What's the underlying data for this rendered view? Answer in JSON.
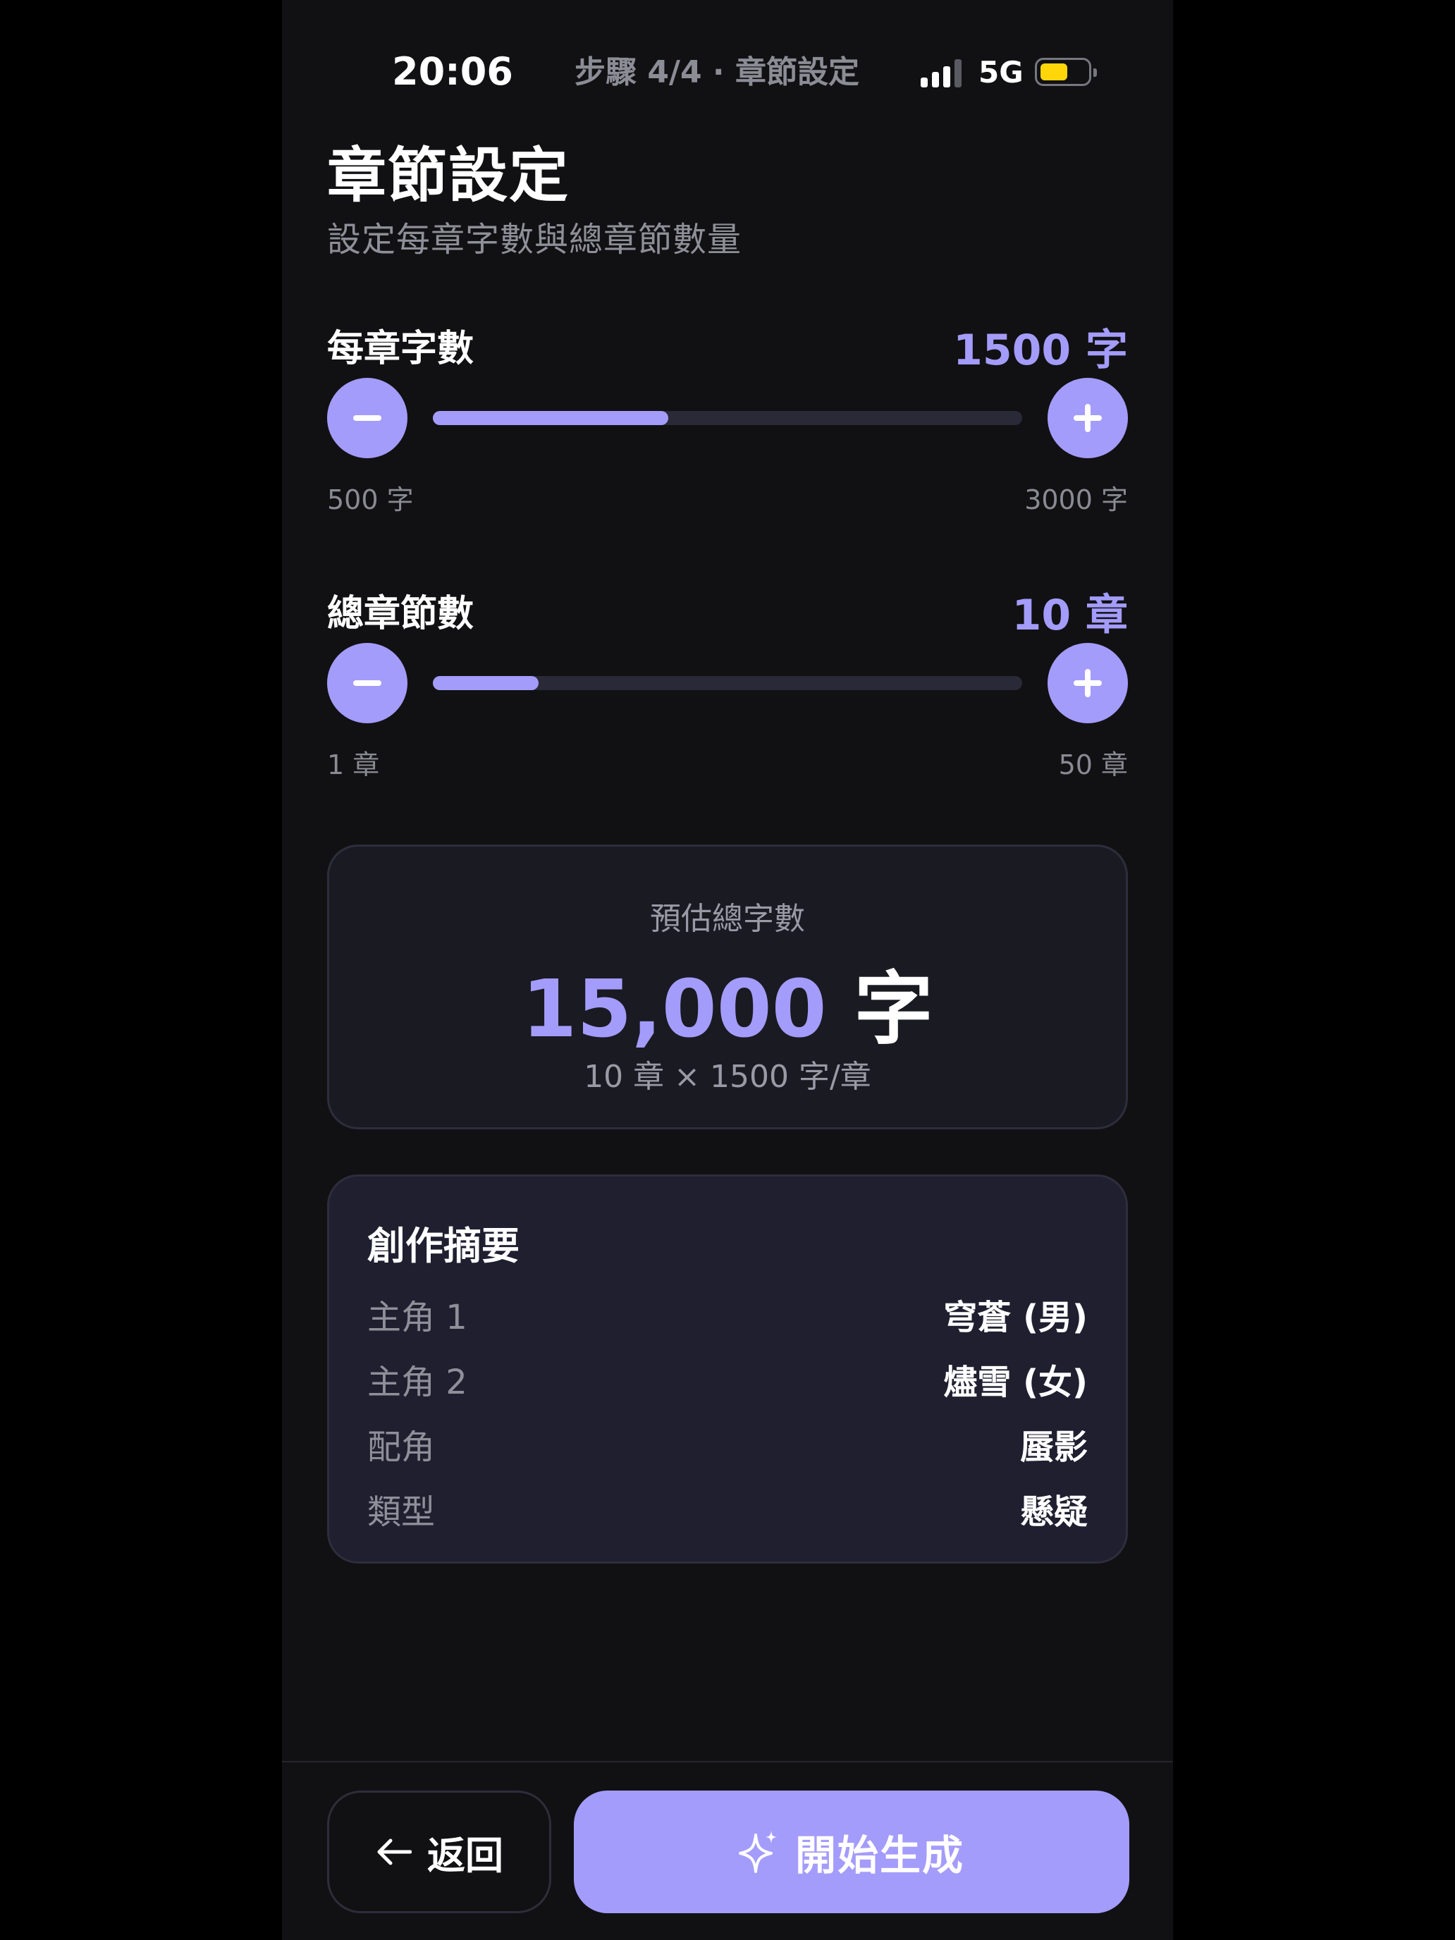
{
  "status_bar": {
    "time": "20:06",
    "step_label": "步驟 4/4 · 章節設定",
    "network": "5G",
    "signal_icon": "signal-bars-icon",
    "battery_icon": "battery-icon"
  },
  "page": {
    "title": "章節設定",
    "subtitle": "設定每章字數與總章節數量"
  },
  "words_per_chapter": {
    "label": "每章字數",
    "value": "1500 字",
    "min_label": "500 字",
    "max_label": "3000 字",
    "fill_fraction": 0.4
  },
  "total_chapters": {
    "label": "總章節數",
    "value": "10 章",
    "min_label": "1 章",
    "max_label": "50 章",
    "fill_fraction": 0.18
  },
  "estimate": {
    "label": "預估總字數",
    "value": "15,000",
    "unit": "字",
    "formula": "10 章 × 1500 字/章"
  },
  "summary": {
    "title": "創作摘要",
    "rows": [
      {
        "key": "主角 1",
        "value": "穹蒼 (男)"
      },
      {
        "key": "主角 2",
        "value": "燼雪 (女)"
      },
      {
        "key": "配角",
        "value": "蜃影"
      },
      {
        "key": "類型",
        "value": "懸疑"
      }
    ]
  },
  "actions": {
    "back_label": "返回",
    "generate_label": "開始生成"
  },
  "colors": {
    "accent": "#a49cfb",
    "background": "#111113",
    "card": "#1f1f30",
    "battery": "#ffd60a"
  }
}
